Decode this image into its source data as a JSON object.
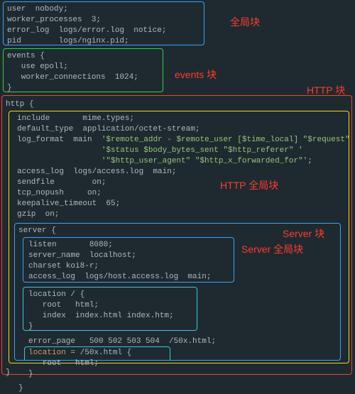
{
  "labels": {
    "global": "全局块",
    "events": "events 块",
    "http": "HTTP 块",
    "http_global": "HTTP 全局块",
    "server": "Server 块",
    "server_global": "Server 全局块"
  },
  "code": {
    "global_block": "user  nobody;\nworker_processes  3;\nerror_log  logs/error.log  notice;\npid        logs/nginx.pid;",
    "events_block": "events {\n   use epoll;\n   worker_connections  1024;\n}",
    "http_open": "http {",
    "http_inner_top": "include       mime.types;\ndefault_type  application/octet-stream;\nlog_format  main  '$remote_addr - $remote_user [$time_local] \"$request\" '\n                  '$status $body_bytes_sent \"$http_referer\" '\n                  '\"$http_user_agent\" \"$http_x_forwarded_for\"';\naccess_log  logs/access.log  main;\nsendfile        on;\ntcp_nopush     on;\nkeepalive_timeout  65;\ngzip  on;",
    "server_open": "server {",
    "server_inner": "listen       8080;\nserver_name  localhost;\ncharset koi8-r;\naccess_log  logs/host.access.log  main;",
    "location_main": "location / {\n   root   html;\n   index  index.html index.htm;\n}",
    "error_page": "error_page   500 502 503 504  /50x.html;",
    "location_50x_kw": "location",
    "location_50x_rest": " = /50x.html {\n   root   html;\n}",
    "server_close": "}",
    "http_close": "}"
  },
  "colors": {
    "global_box": "#3aa0ff",
    "events_box": "#33d24a",
    "http_box": "#ff3b30",
    "http_inner_box": "#ffd60a",
    "server_box": "#3aa0ff",
    "server_inner_box": "#3aa0ff",
    "location_box": "#38c7e0",
    "location50_box": "#38c7e0"
  }
}
